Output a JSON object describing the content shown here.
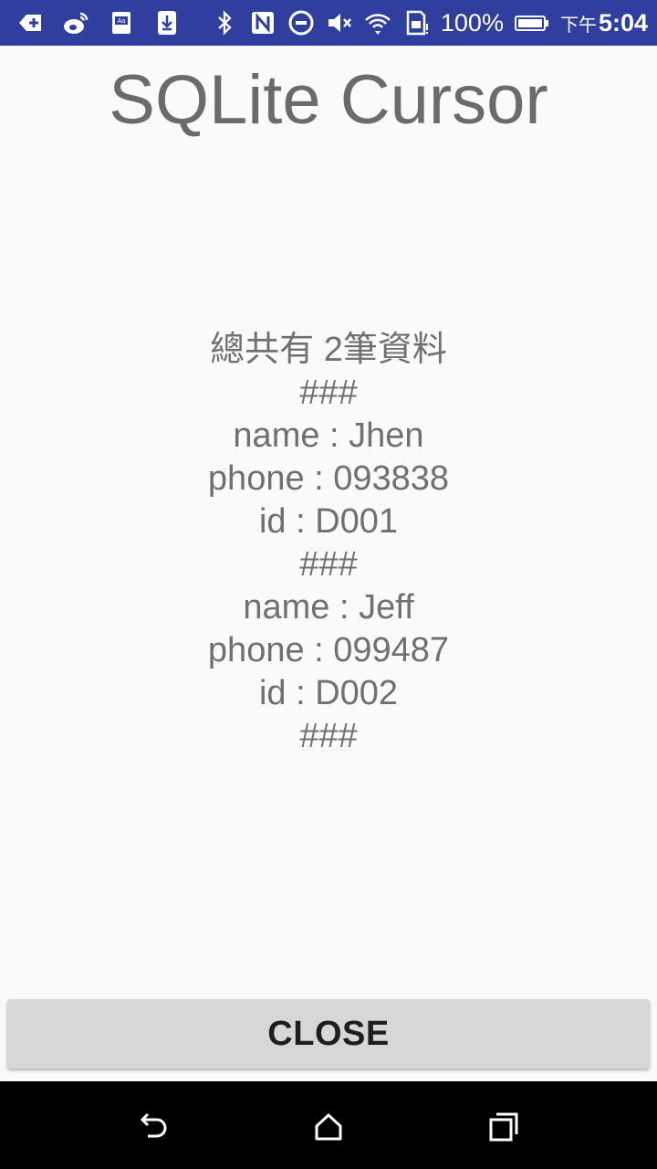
{
  "status_bar": {
    "left_icons": [
      "add-notification-icon",
      "weibo-icon",
      "dictionary-icon",
      "download-icon"
    ],
    "right_icons": [
      "bluetooth-icon",
      "nfc-icon",
      "do-not-disturb-icon",
      "mute-icon",
      "wifi-icon",
      "sim-icon",
      "battery-icon"
    ],
    "battery_percent": "100%",
    "ampm": "下午",
    "time": "5:04",
    "background_color": "#303f9f"
  },
  "title": "SQLite Cursor",
  "records": [
    "總共有 2筆資料",
    "###",
    "name : Jhen",
    "phone : 093838",
    "id : D001",
    "###",
    "name : Jeff",
    "phone : 099487",
    "id : D002",
    "###"
  ],
  "close_button": {
    "label": "CLOSE"
  },
  "nav_bar": {
    "icons": [
      "back-icon",
      "home-icon",
      "recents-icon"
    ]
  }
}
